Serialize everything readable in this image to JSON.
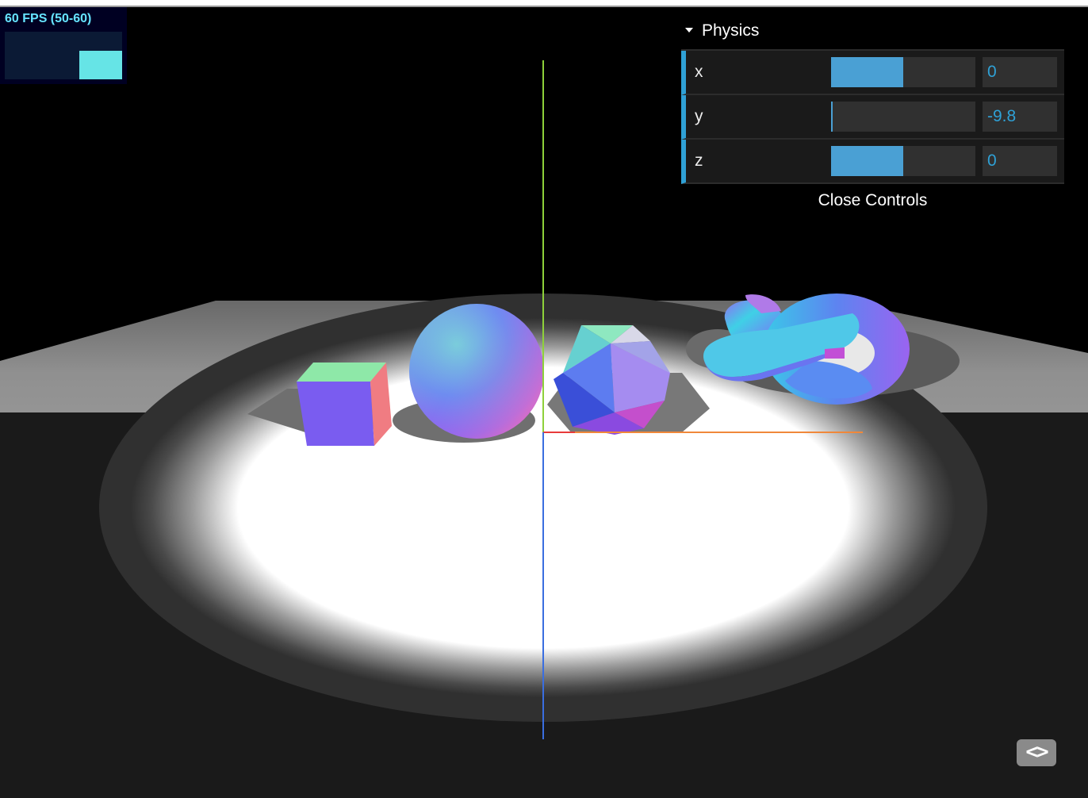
{
  "stats": {
    "fps_text": "60 FPS (50-60)",
    "current_fps_fraction": 0.6
  },
  "gui": {
    "folder_title": "Physics",
    "rows": [
      {
        "label": "x",
        "value": "0",
        "slider_fraction": 0.5
      },
      {
        "label": "y",
        "value": "-9.8",
        "slider_fraction": 0.01
      },
      {
        "label": "z",
        "value": "0",
        "slider_fraction": 0.5
      }
    ],
    "close_label": "Close Controls"
  },
  "code_toggle": {
    "label": "<>"
  },
  "colors": {
    "accent": "#2fa1d6",
    "slider_fill": "#4aa0d4",
    "fps_text": "#66e4ff",
    "axis_x": "#f0883a",
    "axis_y": "#8ed13a",
    "axis_z": "#3a6ee0"
  },
  "icons": {
    "folder_caret": "caret-down-icon",
    "code_toggle": "code-brackets-icon"
  }
}
